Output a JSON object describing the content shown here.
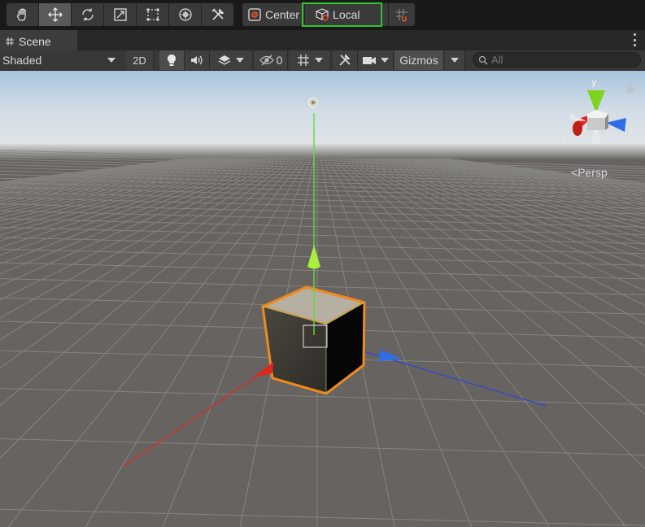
{
  "toolbar": {
    "tools": [
      {
        "name": "hand-tool",
        "icon": "hand-icon",
        "active": false
      },
      {
        "name": "move-tool",
        "icon": "move-arrows-icon",
        "active": true
      },
      {
        "name": "rotate-tool",
        "icon": "rotate-icon",
        "active": false
      },
      {
        "name": "scale-tool",
        "icon": "scale-icon",
        "active": false
      },
      {
        "name": "rect-tool",
        "icon": "rect-transform-icon",
        "active": false
      },
      {
        "name": "transform-tool",
        "icon": "transform-icon",
        "active": false
      },
      {
        "name": "custom-tool",
        "icon": "custom-tools-icon",
        "active": false
      }
    ],
    "pivot_label": "Center",
    "space_label": "Local",
    "snap_icon": "grid-snap-icon"
  },
  "tab": {
    "label": "Scene",
    "icon": "grid-icon"
  },
  "scene_toolbar": {
    "draw_mode": "Shaded",
    "mode_2d": "2D",
    "lighting_icon": "lightbulb-icon",
    "audio_icon": "speaker-icon",
    "effects_icon": "layers-icon",
    "hidden_count": "0",
    "hidden_icon": "eye-slash-icon",
    "grid_icon": "grid-hash-icon",
    "tools_icon": "wrench-icon",
    "camera_icon": "camera-icon",
    "gizmos_label": "Gizmos",
    "search_placeholder": "All",
    "search_value": ""
  },
  "viewport": {
    "projection_label": "Persp",
    "orientation_gizmo": {
      "x_label": "x",
      "y_label": "y",
      "z_label": "z"
    },
    "colors": {
      "sky_top": "#a9c4dd",
      "ground": "#666360",
      "x_axis": "#e0281f",
      "y_axis": "#92e63a",
      "z_axis": "#2f6fe6",
      "selection_outline": "#f08a1c"
    }
  }
}
